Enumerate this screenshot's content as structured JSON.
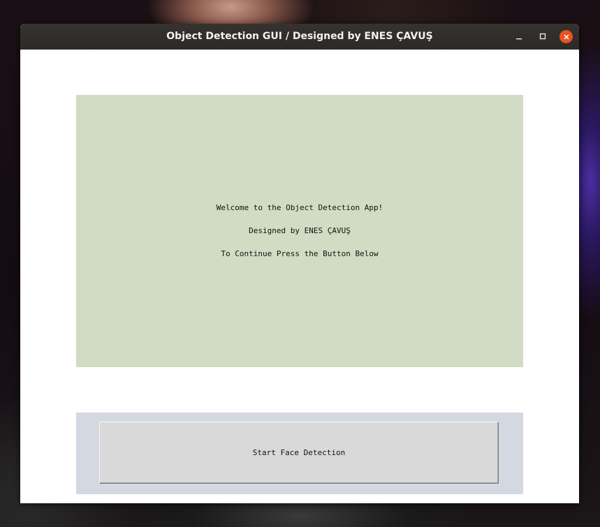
{
  "window": {
    "title": "Object Detection GUI / Designed by ENES ÇAVUŞ",
    "controls": {
      "minimize_icon": "minimize-icon",
      "maximize_icon": "maximize-icon",
      "close_icon": "close-icon"
    }
  },
  "info_panel": {
    "lines": [
      "Welcome to the Object Detection App!",
      "Designed by ENES ÇAVUŞ",
      "To Continue Press the Button Below"
    ]
  },
  "actions": {
    "start_label": "Start Face Detection"
  },
  "colors": {
    "titlebar": "#2c2a27",
    "close_button": "#e95420",
    "info_panel_bg": "#d2dbc3",
    "button_strip_bg": "#d4d8e1",
    "button_bg": "#d9d9d9"
  }
}
